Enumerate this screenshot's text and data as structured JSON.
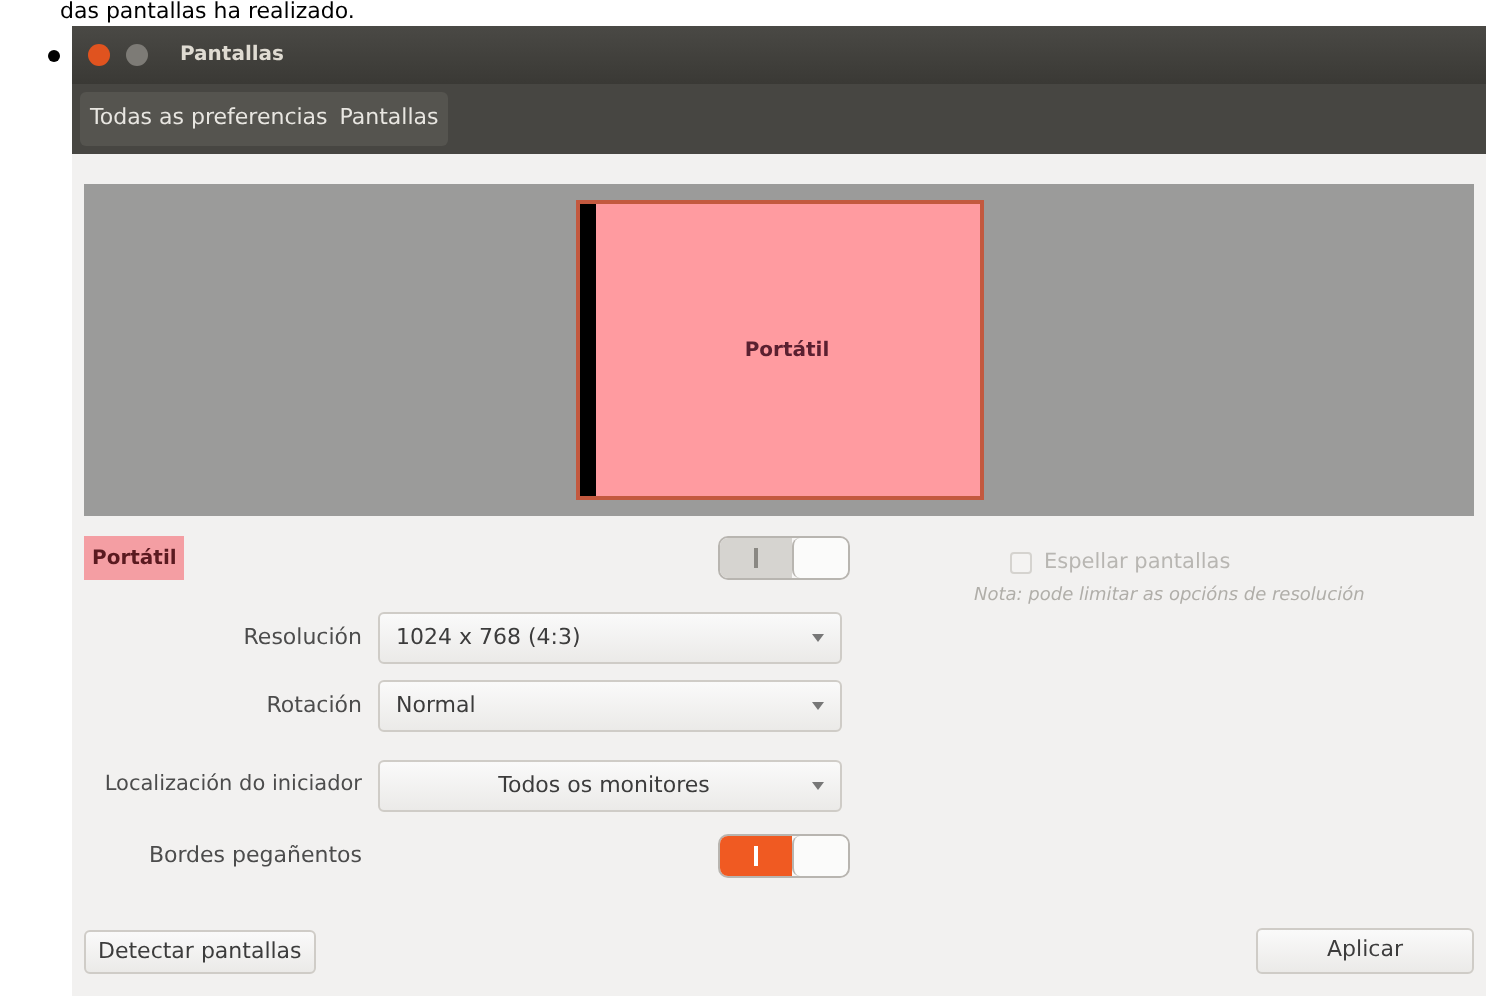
{
  "page_text": "das pantallas ha realizado.",
  "window": {
    "title": "Pantallas"
  },
  "breadcrumbs": [
    {
      "label": "Todas as preferencias"
    },
    {
      "label": "Pantallas"
    }
  ],
  "monitors": [
    {
      "label": "Portátil"
    }
  ],
  "display": {
    "name": "Portátil",
    "on": true,
    "disabled": true
  },
  "fields": [
    {
      "label": "Resolución",
      "value": "1024 x 768 (4:3)"
    },
    {
      "label": "Rotación",
      "value": "Normal"
    }
  ],
  "mirror": {
    "label": "Espellar pantallas",
    "checked": false,
    "disabled": true,
    "note": "Nota: pode limitar as opcións de resolución"
  },
  "launcher": {
    "label": "Localización do iniciador",
    "value": "Todos os monitores"
  },
  "sticky_edges": {
    "label": "Bordes pegañentos",
    "on": true,
    "disabled": false
  },
  "buttons": [
    {
      "label": "Detectar pantallas"
    },
    {
      "label": "Aplicar"
    }
  ]
}
